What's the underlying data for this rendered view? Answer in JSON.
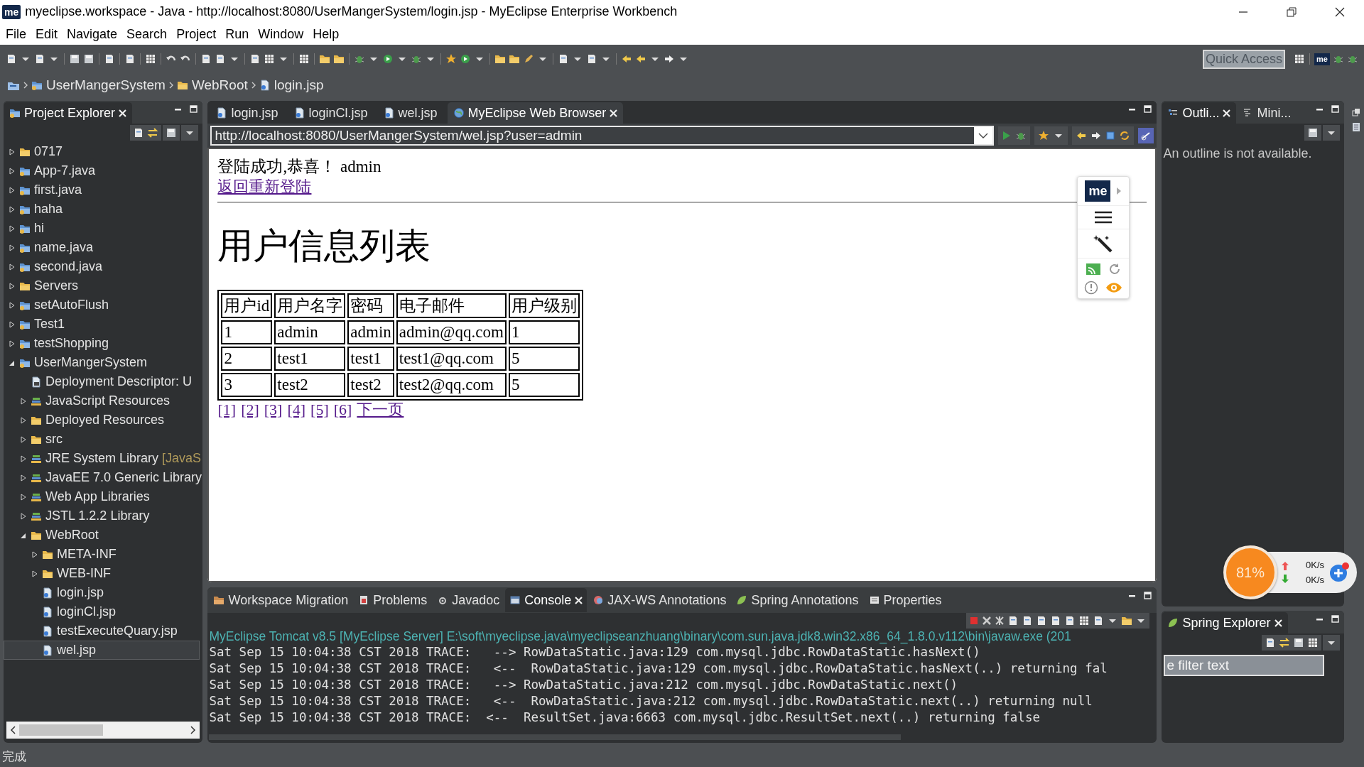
{
  "window": {
    "logo": "me",
    "title": "myeclipse.workspace - Java - http://localhost:8080/UserMangerSystem/login.jsp - MyEclipse Enterprise Workbench"
  },
  "menu": [
    "File",
    "Edit",
    "Navigate",
    "Search",
    "Project",
    "Run",
    "Window",
    "Help"
  ],
  "toolbar": {
    "quick_access": "Quick Access",
    "logo": "me"
  },
  "breadcrumb": [
    {
      "label": "UserMangerSystem",
      "kind": "project"
    },
    {
      "label": "WebRoot",
      "kind": "folder"
    },
    {
      "label": "login.jsp",
      "kind": "file"
    }
  ],
  "project_explorer": {
    "title": "Project Explorer",
    "items": [
      {
        "label": "0717",
        "kind": "folder",
        "expanded": false,
        "selected": false
      },
      {
        "label": "App-7.java",
        "kind": "project",
        "expanded": false,
        "selected": false
      },
      {
        "label": "first.java",
        "kind": "project",
        "expanded": false,
        "selected": false
      },
      {
        "label": "haha",
        "kind": "project",
        "expanded": false,
        "selected": false
      },
      {
        "label": "hi",
        "kind": "project",
        "expanded": false,
        "selected": false
      },
      {
        "label": "name.java",
        "kind": "project",
        "expanded": false,
        "selected": false
      },
      {
        "label": "second.java",
        "kind": "project",
        "expanded": false,
        "selected": false
      },
      {
        "label": "Servers",
        "kind": "folder",
        "expanded": false,
        "selected": false
      },
      {
        "label": "setAutoFlush",
        "kind": "project",
        "expanded": false,
        "selected": false
      },
      {
        "label": "Test1",
        "kind": "project",
        "expanded": false,
        "selected": false
      },
      {
        "label": "testShopping",
        "kind": "project",
        "expanded": false,
        "selected": false
      },
      {
        "label": "UserMangerSystem",
        "kind": "project",
        "expanded": true,
        "selected": false,
        "children": [
          {
            "label": "Deployment Descriptor: U",
            "kind": "descriptor",
            "expanded": false,
            "selected": false
          },
          {
            "label": "JavaScript Resources",
            "kind": "library",
            "expanded": false,
            "selected": false
          },
          {
            "label": "Deployed Resources",
            "kind": "folder",
            "expanded": false,
            "selected": false
          },
          {
            "label": "src",
            "kind": "folder",
            "expanded": false,
            "selected": false
          },
          {
            "label": "JRE System Library",
            "qualifier": "[JavaS",
            "kind": "library",
            "expanded": false,
            "selected": false
          },
          {
            "label": "JavaEE 7.0 Generic Library",
            "kind": "library",
            "expanded": false,
            "selected": false
          },
          {
            "label": "Web App Libraries",
            "kind": "library",
            "expanded": false,
            "selected": false
          },
          {
            "label": "JSTL 1.2.2 Library",
            "kind": "library",
            "expanded": false,
            "selected": false
          },
          {
            "label": "WebRoot",
            "kind": "folder",
            "expanded": true,
            "selected": false,
            "children": [
              {
                "label": "META-INF",
                "kind": "folder",
                "expanded": false,
                "selected": false
              },
              {
                "label": "WEB-INF",
                "kind": "folder",
                "expanded": false,
                "selected": false
              },
              {
                "label": "login.jsp",
                "kind": "file",
                "expanded": false,
                "selected": false
              },
              {
                "label": "loginCl.jsp",
                "kind": "file",
                "expanded": false,
                "selected": false
              },
              {
                "label": "testExecuteQuary.jsp",
                "kind": "file",
                "expanded": false,
                "selected": false
              },
              {
                "label": "wel.jsp",
                "kind": "file",
                "expanded": false,
                "selected": true
              }
            ]
          }
        ]
      }
    ]
  },
  "editor": {
    "tabs": [
      {
        "label": "login.jsp",
        "kind": "file",
        "selected": false
      },
      {
        "label": "loginCl.jsp",
        "kind": "file",
        "selected": false
      },
      {
        "label": "wel.jsp",
        "kind": "file",
        "selected": false
      },
      {
        "label": "MyEclipse Web Browser",
        "kind": "browser",
        "selected": true
      }
    ],
    "url": "http://localhost:8080/UserMangerSystem/wel.jsp?user=admin",
    "page": {
      "greeting": "登陆成功,恭喜！ admin",
      "relogin_link": "返回重新登陆",
      "heading": "用户信息列表",
      "table": {
        "columns": [
          "用户id",
          "用户名字",
          "密码",
          "电子邮件",
          "用户级别"
        ],
        "rows": [
          [
            "1",
            "admin",
            "admin",
            "admin@qq.com",
            "1"
          ],
          [
            "2",
            "test1",
            "test1",
            "test1@qq.com",
            "5"
          ],
          [
            "3",
            "test2",
            "test2",
            "test2@qq.com",
            "5"
          ]
        ]
      },
      "pager": [
        "[1]",
        "[2]",
        "[3]",
        "[4]",
        "[5]",
        "[6]",
        "下一页"
      ]
    },
    "extension_widget": {
      "logo": "me"
    }
  },
  "console": {
    "tabs": [
      {
        "label": "Workspace Migration",
        "kind": "migration",
        "selected": false
      },
      {
        "label": "Problems",
        "kind": "problems",
        "selected": false
      },
      {
        "label": "Javadoc",
        "kind": "javadoc",
        "selected": false
      },
      {
        "label": "Console",
        "kind": "console",
        "selected": true
      },
      {
        "label": "JAX-WS Annotations",
        "kind": "jaxws",
        "selected": false
      },
      {
        "label": "Spring Annotations",
        "kind": "spring",
        "selected": false
      },
      {
        "label": "Properties",
        "kind": "properties",
        "selected": false
      }
    ],
    "process": "MyEclipse Tomcat v8.5 [MyEclipse Server] E:\\soft\\myeclipse.java\\myeclipseanzhuang\\binary\\com.sun.java.jdk8.win32.x86_64_1.8.0.v112\\bin\\javaw.exe (201",
    "lines": [
      "Sat Sep 15 10:04:38 CST 2018 TRACE:   --> RowDataStatic.java:129 com.mysql.jdbc.RowDataStatic.hasNext()",
      "Sat Sep 15 10:04:38 CST 2018 TRACE:   <--  RowDataStatic.java:129 com.mysql.jdbc.RowDataStatic.hasNext(..) returning fal",
      "Sat Sep 15 10:04:38 CST 2018 TRACE:   --> RowDataStatic.java:212 com.mysql.jdbc.RowDataStatic.next()",
      "Sat Sep 15 10:04:38 CST 2018 TRACE:   <--  RowDataStatic.java:212 com.mysql.jdbc.RowDataStatic.next(..) returning null",
      "Sat Sep 15 10:04:38 CST 2018 TRACE:  <--  ResultSet.java:6663 com.mysql.jdbc.ResultSet.next(..) returning false"
    ]
  },
  "outline": {
    "tabs": [
      {
        "label": "Outli...",
        "kind": "outline",
        "selected": true
      },
      {
        "label": "Mini...",
        "kind": "minimap",
        "selected": false
      }
    ],
    "message": "An outline is not available."
  },
  "spring_explorer": {
    "title": "Spring Explorer",
    "filter_placeholder": "e filter text"
  },
  "speed_meter": {
    "percent": "81%",
    "upload": "0K/s",
    "download": "0K/s"
  },
  "status_bar": {
    "text": "完成"
  }
}
